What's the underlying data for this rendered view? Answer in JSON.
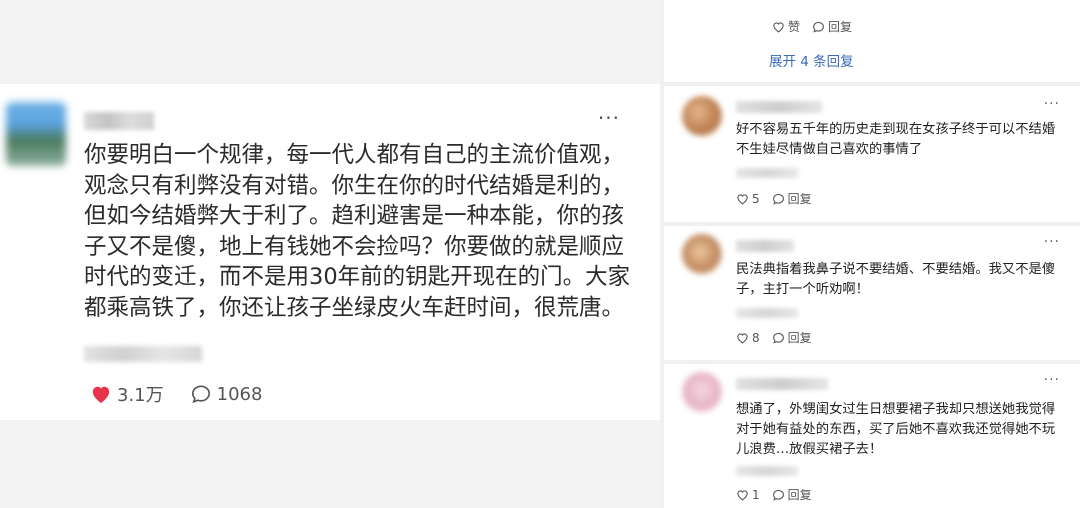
{
  "post": {
    "text": "你要明白一个规律，每一代人都有自己的主流价值观，\n观念只有利弊没有对错。你生在你的时代结婚是利的，\n但如今结婚弊大于利了。趋利避害是一种本能，你的孩\n子又不是傻，地上有钱她不会捡吗？你要做的就是顺应\n时代的变迁，而不是用30年前的钥匙开现在的门。大家\n都乘高铁了，你还让孩子坐绿皮火车赶时间，很荒唐。",
    "more_label": "···",
    "likes": "3.1万",
    "comments": "1068",
    "like_color": "#e8334a"
  },
  "thread": {
    "top_like_label": "赞",
    "top_reply_label": "回复",
    "expand_label": "展开 4 条回复"
  },
  "comments": [
    {
      "text": "好不容易五千年的历史走到现在女孩子终于可以不结婚\n不生娃尽情做自己喜欢的事情了",
      "likes": "5",
      "reply_label": "回复",
      "more_label": "···"
    },
    {
      "text": "民法典指着我鼻子说不要结婚、不要结婚。我又不是傻\n子，主打一个听劝啊！",
      "likes": "8",
      "reply_label": "回复",
      "more_label": "···"
    },
    {
      "text": "想通了，外甥闺女过生日想要裙子我却只想送她我觉得\n对于她有益处的东西，买了后她不喜欢我还觉得她不玩\n儿浪费…放假买裙子去！",
      "likes": "1",
      "reply_label": "回复",
      "more_label": "···"
    }
  ]
}
